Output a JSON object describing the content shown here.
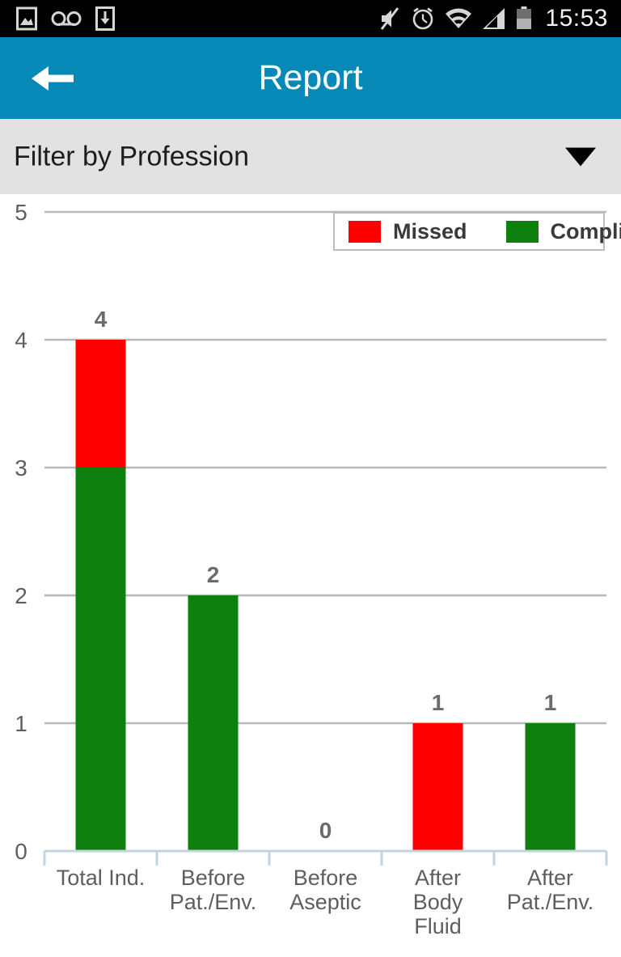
{
  "status_bar": {
    "left_icons": [
      {
        "name": "image-icon",
        "label": "Screenshot captured"
      },
      {
        "name": "voicemail-icon",
        "label": "Voicemail"
      },
      {
        "name": "download-icon",
        "label": "Download complete"
      }
    ],
    "right_icons": [
      {
        "name": "mute-icon",
        "label": "Silent mode"
      },
      {
        "name": "alarm-clock-icon",
        "label": "Alarm set"
      },
      {
        "name": "wifi-icon",
        "label": "Wi-Fi connected"
      },
      {
        "name": "cellular-signal-icon",
        "label": "Cellular signal"
      },
      {
        "name": "battery-icon",
        "label": "Battery"
      }
    ],
    "clock": "15:53"
  },
  "app_bar": {
    "title": "Report",
    "back_icon": "arrow-left-icon",
    "background": "#0789b8",
    "text_color": "#ffffff"
  },
  "filter": {
    "label": "Filter by Profession",
    "caret_icon": "triangle-down-icon",
    "background": "#e2e2e2"
  },
  "legend": {
    "items": [
      {
        "label": "Missed",
        "color": "#ff0000"
      },
      {
        "label": "Complied",
        "color": "#0e800e"
      }
    ]
  },
  "chart_data": {
    "type": "bar",
    "title": "",
    "xlabel": "",
    "ylabel": "",
    "ylim": [
      0,
      5
    ],
    "yticks": [
      "0",
      "1",
      "2",
      "3",
      "4",
      "5"
    ],
    "grid": true,
    "stacked": true,
    "legend_position": "top-right",
    "categories": [
      "Total Ind.",
      "Before Pat./Env.",
      "Before Aseptic",
      "After Body Fluid",
      "After Pat./Env."
    ],
    "category_lines": [
      [
        "Total Ind."
      ],
      [
        "Before",
        "Pat./Env."
      ],
      [
        "Before",
        "Aseptic"
      ],
      [
        "After",
        "Body",
        "Fluid"
      ],
      [
        "After",
        "Pat./Env."
      ]
    ],
    "series": [
      {
        "name": "Complied",
        "color": "#0e800e",
        "values": [
          3,
          2,
          0,
          0,
          1
        ]
      },
      {
        "name": "Missed",
        "color": "#ff0000",
        "values": [
          1,
          0,
          0,
          1,
          0
        ]
      }
    ],
    "totals": [
      4,
      2,
      0,
      1,
      1
    ],
    "data_labels": [
      "4",
      "2",
      "0",
      "1",
      "1"
    ],
    "colors": {
      "gridline": "#b8b8b8",
      "axis": "#c3d4de",
      "tick_text": "#5e5e5e",
      "label_text": "#6b6b6b",
      "category_text": "#5e5e5e"
    }
  }
}
